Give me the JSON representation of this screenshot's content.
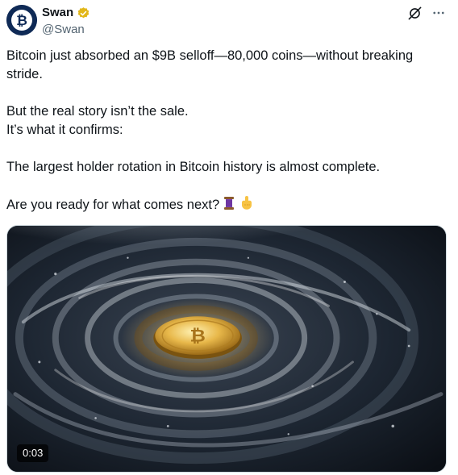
{
  "author": {
    "name": "Swan",
    "handle": "@Swan",
    "avatar_icon": "bitcoin-logo-icon",
    "verified_badge_color": "#e2b719"
  },
  "tweet": {
    "paragraphs": [
      "Bitcoin just absorbed an $9B selloff—80,000 coins—without breaking stride.",
      "But the real story isn’t the sale.",
      "It’s what it confirms:",
      "The largest holder rotation in Bitcoin history is almost complete.",
      "Are you ready for what comes next?"
    ],
    "emojis": [
      "thread-spool-icon",
      "pointing-down-icon"
    ]
  },
  "media": {
    "type": "video",
    "duration": "0:03",
    "description_icon": "bitcoin-vortex-image"
  },
  "actions": {
    "grok_icon": "grok-icon",
    "more_icon": "more-options-icon"
  },
  "colors": {
    "text": "#0f1419",
    "secondary": "#536471",
    "avatar_bg": "#0f2a56",
    "bitcoin_orange": "#f7931a"
  }
}
